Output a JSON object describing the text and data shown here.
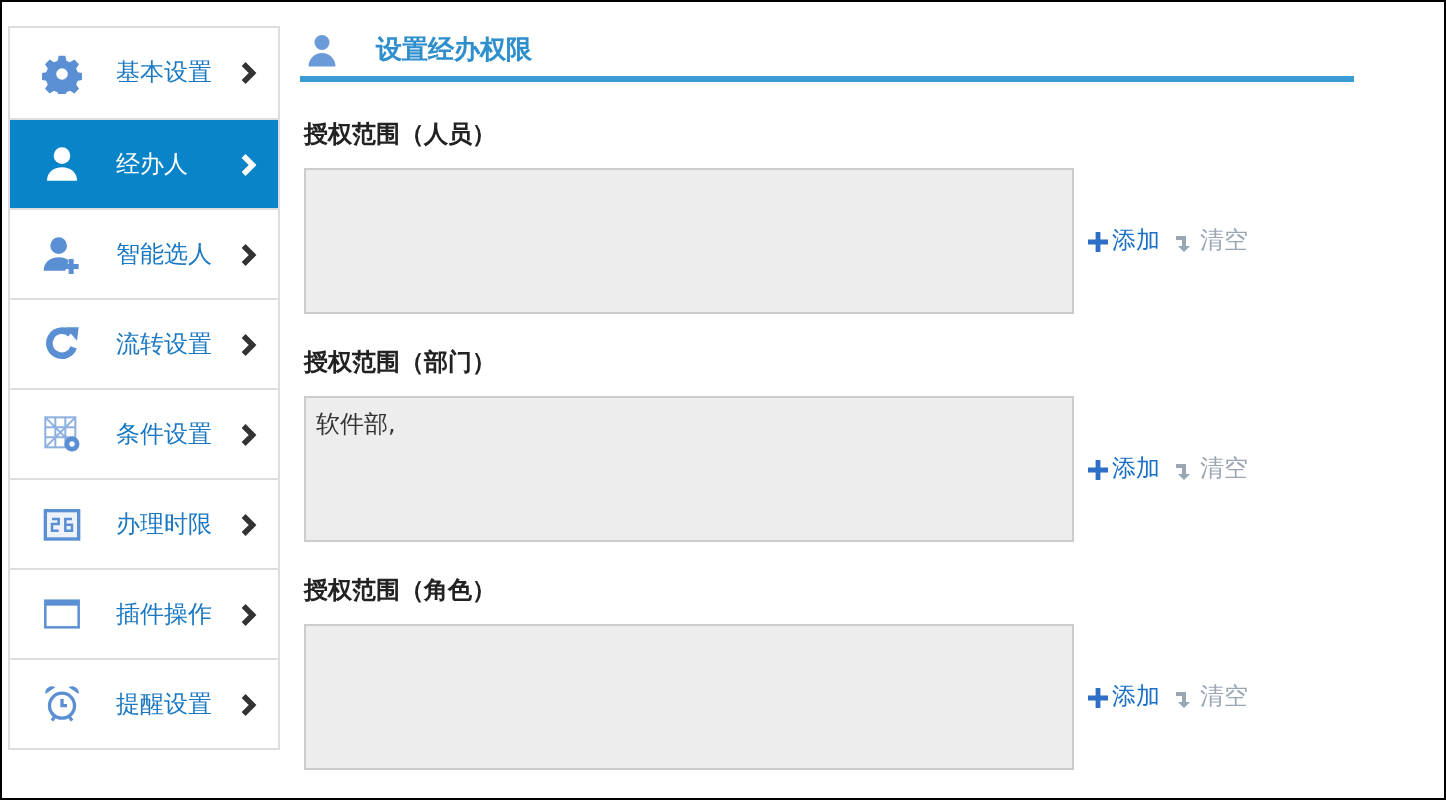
{
  "sidebar": {
    "items": [
      {
        "label": "基本设置",
        "selected": false
      },
      {
        "label": "经办人",
        "selected": true
      },
      {
        "label": "智能选人",
        "selected": false
      },
      {
        "label": "流转设置",
        "selected": false
      },
      {
        "label": "条件设置",
        "selected": false
      },
      {
        "label": "办理时限",
        "selected": false
      },
      {
        "label": "插件操作",
        "selected": false
      },
      {
        "label": "提醒设置",
        "selected": false
      }
    ]
  },
  "header": {
    "title": "设置经办权限"
  },
  "sections": [
    {
      "label": "授权范围（人员）",
      "add": "添加",
      "clear": "清空"
    },
    {
      "label": "授权范围（部门）",
      "value": "软件部,",
      "add": "添加",
      "clear": "清空"
    },
    {
      "label": "授权范围（角色）",
      "add": "添加",
      "clear": "清空"
    }
  ]
}
